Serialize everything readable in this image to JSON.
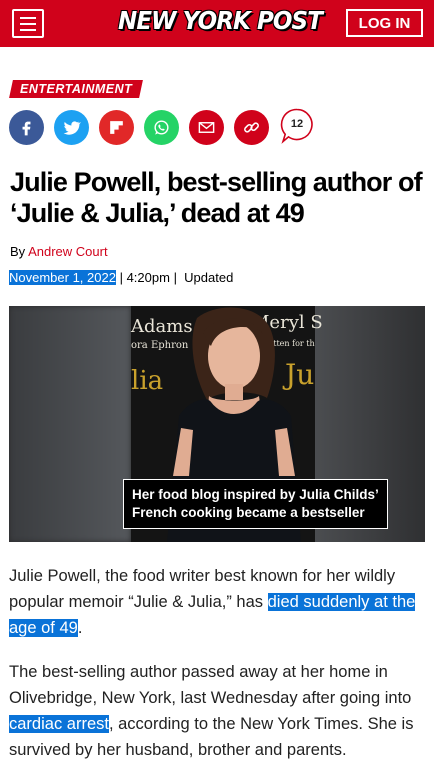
{
  "header": {
    "logo": "NEW YORK POST",
    "login_label": "LOG IN"
  },
  "article": {
    "section": "ENTERTAINMENT",
    "share": {
      "comment_count": "12",
      "icons": [
        "facebook-icon",
        "twitter-icon",
        "flipboard-icon",
        "whatsapp-icon",
        "email-icon",
        "link-icon"
      ]
    },
    "headline": "Julie Powell, best-selling author of ‘Julie & Julia,’ dead at 49",
    "byline_prefix": "By ",
    "author": "Andrew Court",
    "date": "November 1, 2022",
    "time": "4:20pm",
    "updated_label": "Updated",
    "photo": {
      "caption_line1": "Her food blog inspired by Julia Childs’",
      "caption_line2": "French cooking became a bestseller",
      "poster_text_1": "Adams",
      "poster_text_2": "ora Ephron",
      "poster_text_3": "lia",
      "poster_text_4": "Meryl S",
      "poster_text_5": "Written for th",
      "poster_text_6": "Ju"
    },
    "p1_a": "Julie Powell, the food writer best known for her wildly popular memoir “Julie & Julia,” has ",
    "p1_link": "died suddenly at the age of 49",
    "p1_b": ".",
    "p2_a": "The best-selling author passed away at her home in Olivebridge, New York, last Wednesday after going into ",
    "p2_link": "cardiac arrest",
    "p2_b": ", according to the New York Times. She is survived by her husband, brother and parents."
  },
  "colors": {
    "brand_red": "#d0021b",
    "facebook": "#3b5998",
    "twitter": "#1da1f2",
    "flipboard": "#e12828",
    "whatsapp": "#25d366",
    "email": "#d0021b",
    "link": "#d0021b",
    "selection": "#0a73d8"
  }
}
